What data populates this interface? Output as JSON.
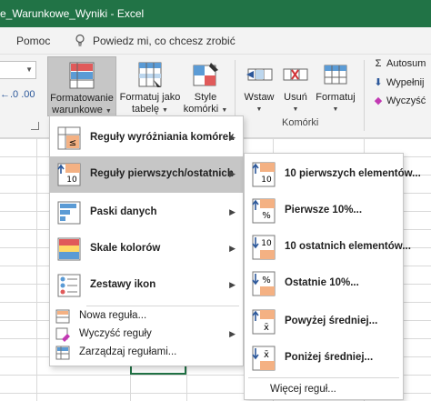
{
  "window": {
    "title": "e_Warunkowe_Wyniki  -  Excel"
  },
  "tabs": {
    "help": "Pomoc",
    "tell_me": "Powiedz mi, co chcesz zrobić"
  },
  "ribbon": {
    "number_format_arrows": "←.0  .00",
    "conditional_formatting": {
      "line1": "Formatowanie",
      "line2": "warunkowe"
    },
    "format_as_table": {
      "line1": "Formatuj jako",
      "line2": "tabelę"
    },
    "cell_styles": {
      "line1": "Style",
      "line2": "komórki"
    },
    "insert": "Wstaw",
    "delete": "Usuń",
    "format": "Formatuj",
    "cells_group": "Komórki",
    "autosum": "Autosum",
    "fill": "Wypełnij",
    "clear": "Wyczyść"
  },
  "menu": {
    "highlight_rules": "Reguły wyróżniania komórek",
    "top_bottom_rules": "Reguły pierwszych/ostatnich",
    "data_bars": "Paski danych",
    "color_scales": "Skale kolorów",
    "icon_sets": "Zestawy ikon",
    "new_rule": "Nowa reguła...",
    "clear_rules": "Wyczyść reguły",
    "manage_rules": "Zarządzaj regułami..."
  },
  "submenu": {
    "top10": "10 pierwszych elementów...",
    "top10pct": "Pierwsze 10%...",
    "bottom10": "10 ostatnich elementów...",
    "bottom10pct": "Ostatnie 10%...",
    "above_avg": "Powyżej średniej...",
    "below_avg": "Poniżej średniej...",
    "more_rules": "Więcej reguł..."
  },
  "icon_labels": {
    "top_item": "10",
    "pct": "%",
    "avg": "x̄",
    "sel": "≤"
  },
  "colors": {
    "excel_green": "#217346",
    "highlight": "#c6c6c6",
    "accent_blue": "#2b579a"
  }
}
